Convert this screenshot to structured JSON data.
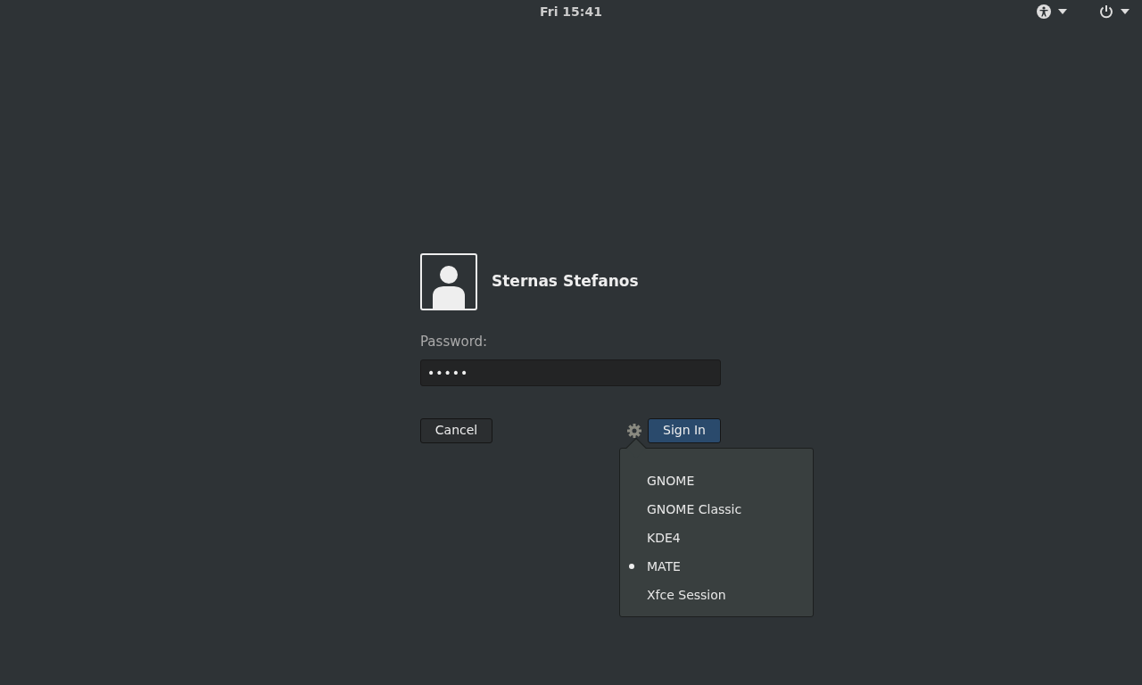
{
  "top_bar": {
    "clock": "Fri 15:41"
  },
  "user": {
    "name": "Sternas Stefanos"
  },
  "password": {
    "label": "Password:",
    "value": "•••••"
  },
  "buttons": {
    "cancel": "Cancel",
    "sign_in": "Sign In"
  },
  "session_menu": {
    "items": [
      {
        "label": "GNOME",
        "selected": false
      },
      {
        "label": "GNOME Classic",
        "selected": false
      },
      {
        "label": "KDE4",
        "selected": false
      },
      {
        "label": "MATE",
        "selected": true
      },
      {
        "label": "Xfce Session",
        "selected": false
      }
    ]
  }
}
